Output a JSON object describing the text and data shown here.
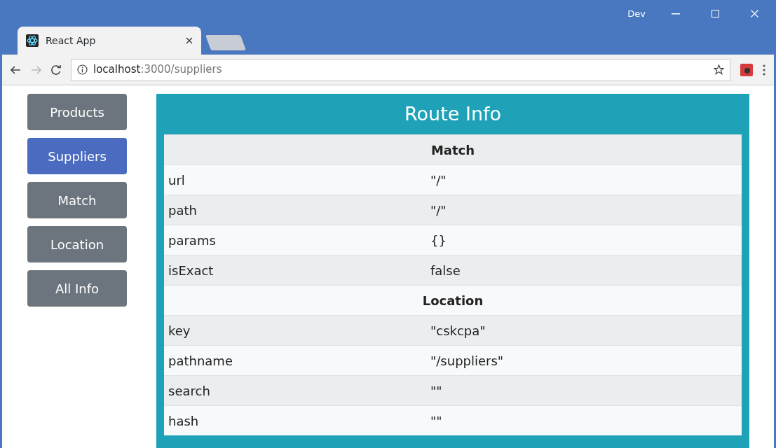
{
  "browser": {
    "profile": "Dev",
    "tab_title": "React App",
    "url_host": "localhost",
    "url_path": ":3000/suppliers"
  },
  "nav_buttons": [
    {
      "label": "Products",
      "selected": false
    },
    {
      "label": "Suppliers",
      "selected": true
    },
    {
      "label": "Match",
      "selected": false
    },
    {
      "label": "Location",
      "selected": false
    },
    {
      "label": "All Info",
      "selected": false
    }
  ],
  "panel": {
    "title": "Route Info",
    "rows": [
      {
        "kind": "heading",
        "label": "Match"
      },
      {
        "kind": "pair",
        "name": "url",
        "value": "\"/\""
      },
      {
        "kind": "pair",
        "name": "path",
        "value": "\"/\""
      },
      {
        "kind": "pair",
        "name": "params",
        "value": "{}"
      },
      {
        "kind": "pair",
        "name": "isExact",
        "value": "false"
      },
      {
        "kind": "heading",
        "label": "Location"
      },
      {
        "kind": "pair",
        "name": "key",
        "value": "\"cskcpa\""
      },
      {
        "kind": "pair",
        "name": "pathname",
        "value": "\"/suppliers\""
      },
      {
        "kind": "pair",
        "name": "search",
        "value": "\"\""
      },
      {
        "kind": "pair",
        "name": "hash",
        "value": "\"\""
      }
    ]
  }
}
